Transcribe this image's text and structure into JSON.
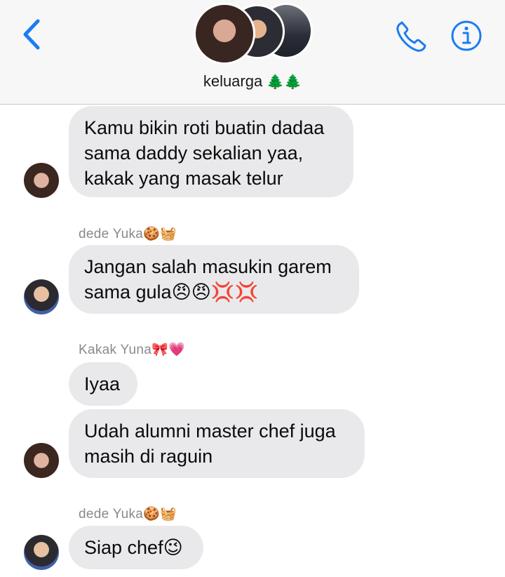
{
  "header": {
    "group_name": "keluarga",
    "group_emoji": "🌲🌲"
  },
  "messages": [
    {
      "text": "Kamu bikin roti buatin dadaa\nsama daddy sekalian yaa,\nkakak yang masak telur"
    },
    {
      "sender": "dede Yuka🍪🧺",
      "text": "Jangan salah masukin garem\nsama gula😠😠💢💢"
    },
    {
      "sender": "Kakak Yuna🎀💗",
      "text": "Iyaa"
    },
    {
      "text": "Udah alumni master chef juga\nmasih di raguin"
    },
    {
      "sender": "dede Yuka🍪🧺",
      "text": "Siap chef😉"
    }
  ],
  "colors": {
    "accent": "#1a7cf5",
    "bubble": "#e9e9eb",
    "header_bg": "#f7f7f7",
    "sender_text": "#8a8a8e"
  },
  "icons": [
    "chevron-left-icon",
    "phone-icon",
    "info-icon"
  ]
}
